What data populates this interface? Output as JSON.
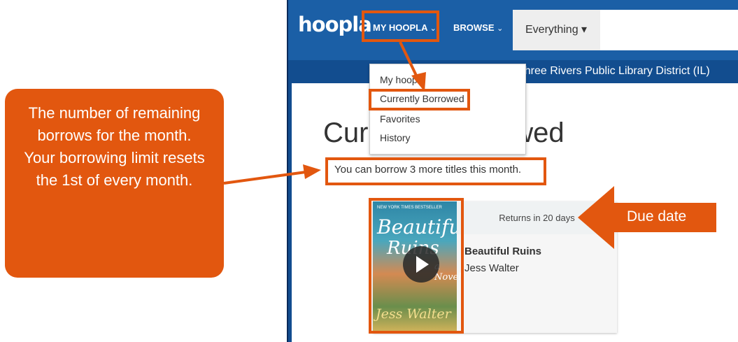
{
  "header": {
    "logo": "hoopla",
    "nav": {
      "my_hoopla": "MY HOOPLA",
      "browse": "BROWSE",
      "chevron": "⌄"
    },
    "search_scope": "Everything ▾",
    "library_name": "Three Rivers Public Library District (IL)"
  },
  "menu": {
    "items": [
      "My hoopla",
      "Currently Borrowed",
      "Favorites",
      "History"
    ]
  },
  "main": {
    "title": "Currently Borrowed",
    "borrow_text": "You can borrow 3 more titles this month."
  },
  "card": {
    "returns": "Returns in 20 days",
    "title": "Beautiful Ruins",
    "author": "Jess Walter",
    "cover": {
      "top_line": "NEW YORK TIMES BESTSELLER",
      "title_line1": "Beautiful",
      "title_line2": "Ruins",
      "subtitle": "a Novel",
      "author": "Jess Walter"
    }
  },
  "annotations": {
    "left_callout": "The number of remaining borrows for the month. Your borrowing limit resets the 1st of every month.",
    "due_callout": "Due date"
  },
  "colors": {
    "brand_blue": "#1b5fa6",
    "dark_blue": "#124d8f",
    "annotation_orange": "#e2570f"
  }
}
